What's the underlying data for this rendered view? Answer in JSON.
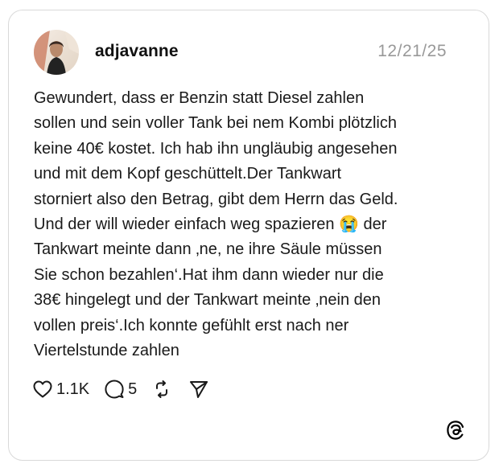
{
  "post": {
    "username": "adjavanne",
    "date": "12/21/25",
    "text": "Gewundert, dass er Benzin statt Diesel zahlen\nsollen und sein voller Tank bei nem Kombi plötzlich\nkeine 40€ kostet. Ich hab ihn ungläubig angesehen\nund mit dem Kopf geschüttelt.Der Tankwart\nstorniert also den Betrag, gibt dem Herrn das Geld.\nUnd der will wieder einfach weg spazieren 😭 der\nTankwart meinte dann ‚ne, ne ihre Säule müssen\nSie schon bezahlen‘.Hat ihm dann wieder nur die\n38€ hingelegt und der Tankwart meinte ‚nein den\nvollen preis‘.Ich konnte gefühlt erst nach ner\nViertelstunde zahlen"
  },
  "actions": {
    "likes": "1.1K",
    "replies": "5",
    "icons": [
      "heart-icon",
      "comment-icon",
      "repost-icon",
      "share-icon"
    ]
  },
  "branding": {
    "logo": "threads-logo-icon"
  },
  "colors": {
    "text": "#1a1a1a",
    "muted": "#999999",
    "border": "#d9d9d9"
  }
}
